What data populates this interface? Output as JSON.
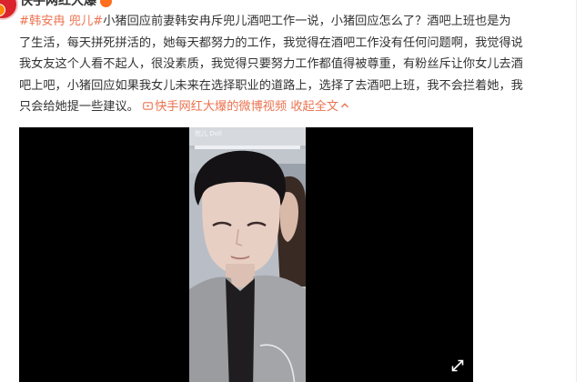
{
  "post": {
    "author_name": "快手网红大爆",
    "hashtag": "#韩安冉 兜儿#",
    "text_line1_rest": "小猪回应前妻韩安冉斥兜儿酒吧工作一说，小猪回应怎么了？酒吧上班也是为",
    "text_line2": "了生活，每天拼死拼活的，她每天都努力的工作，我觉得在酒吧工作没有任何问题啊，我觉得说",
    "text_line3": "我女友这个人看不起人，很没素质，我觉得只要努力工作都值得被尊重，有粉丝斥让你女儿去酒",
    "text_line4": "吧上吧，小猪回应如果我女儿未来在选择职业的道路上，选择了去酒吧上班，我不会拦着她，我",
    "text_line5_start": "只会给她提一些建议。",
    "video_link_label": "快手网红大爆的微博视频",
    "collapse_label": "收起全文"
  },
  "video": {
    "frame_label": "兜儿 Doll"
  },
  "colors": {
    "link": "#eb7350",
    "text": "#333333",
    "video_bg": "#000000"
  },
  "icons": {
    "video_link": "video-link-icon",
    "collapse": "chevron-up-icon",
    "fullscreen": "fullscreen-arrows-icon",
    "avatar_badge": "verified-badge-icon"
  }
}
